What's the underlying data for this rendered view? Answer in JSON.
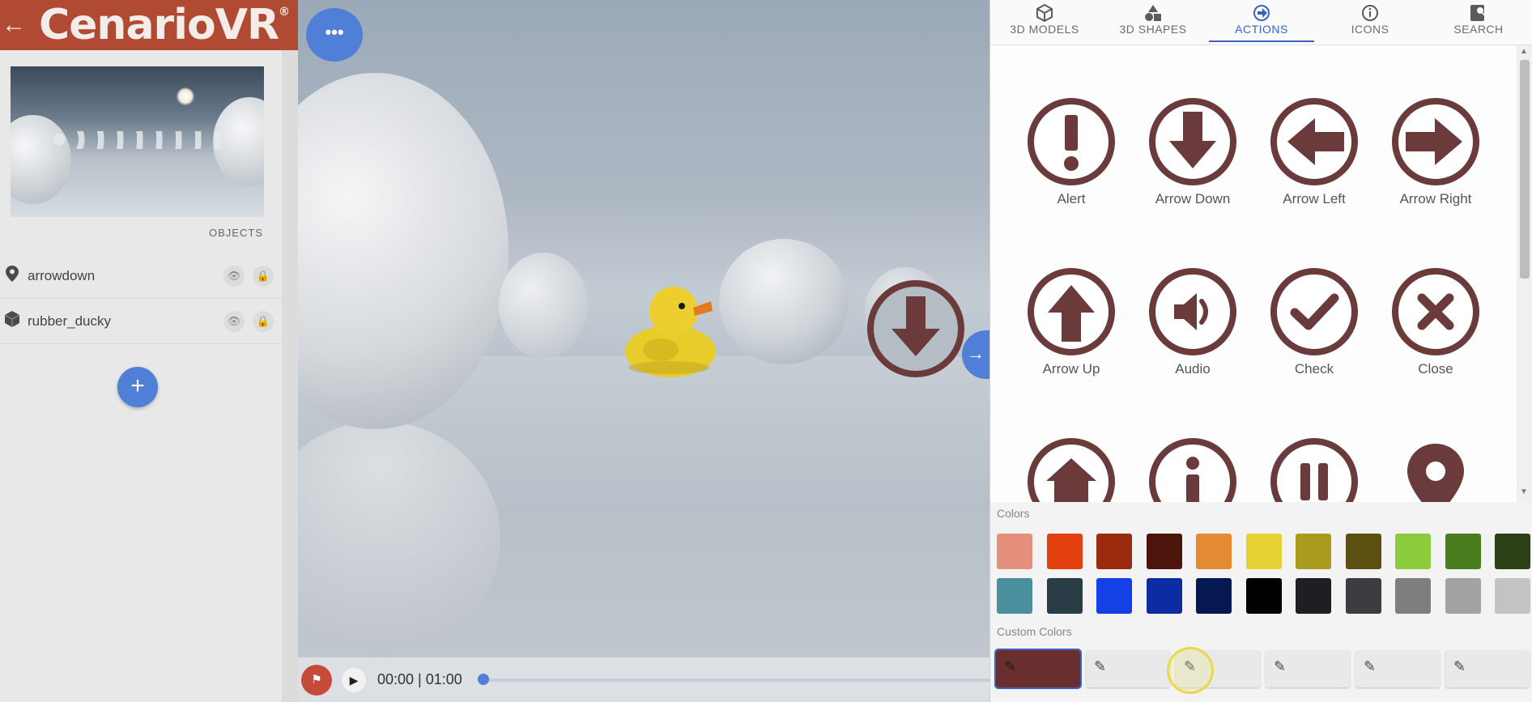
{
  "app": {
    "logo_text": "CenarioVR",
    "back_icon": "arrow-left-icon"
  },
  "sidebar": {
    "objects_label": "OBJECTS",
    "objects": [
      {
        "name": "arrowdown",
        "icon": "map-pin-icon"
      },
      {
        "name": "rubber_ducky",
        "icon": "cube-icon"
      }
    ],
    "add_button": "+"
  },
  "viewport": {
    "menu_button": "•••",
    "next_arrow": "→"
  },
  "timeline": {
    "time_readout": "00:00 | 01:00",
    "progress": 0
  },
  "panel": {
    "tabs": [
      {
        "label": "3D MODELS",
        "icon": "cube-icon"
      },
      {
        "label": "3D SHAPES",
        "icon": "shapes-icon"
      },
      {
        "label": "ACTIONS",
        "icon": "action-arrow-icon",
        "active": true
      },
      {
        "label": "ICONS",
        "icon": "info-icon"
      },
      {
        "label": "SEARCH",
        "icon": "search-icon"
      }
    ],
    "action_icons": [
      {
        "label": "Alert",
        "icon": "alert-icon"
      },
      {
        "label": "Arrow Down",
        "icon": "arrow-down-icon"
      },
      {
        "label": "Arrow Left",
        "icon": "arrow-left-icon"
      },
      {
        "label": "Arrow Right",
        "icon": "arrow-right-icon"
      },
      {
        "label": "Arrow Up",
        "icon": "arrow-up-icon"
      },
      {
        "label": "Audio",
        "icon": "audio-icon"
      },
      {
        "label": "Check",
        "icon": "check-icon"
      },
      {
        "label": "Close",
        "icon": "close-icon"
      },
      {
        "label": "",
        "icon": "home-icon"
      },
      {
        "label": "",
        "icon": "info-icon"
      },
      {
        "label": "",
        "icon": "pause-icon"
      },
      {
        "label": "",
        "icon": "location-pin-icon"
      }
    ],
    "icon_color": "#6b3a3a",
    "colors_title": "Colors",
    "colors": [
      "#e4907c",
      "#e2400f",
      "#9a2a0e",
      "#4d140c",
      "#e38a33",
      "#e6d232",
      "#aa9a1d",
      "#5b4f12",
      "#8bcb3c",
      "#4a7d1e",
      "#2b4015",
      "#7fd2e6",
      "#4a8f9e",
      "#2a3d47",
      "#1540e6",
      "#0d2ba3",
      "#061852",
      "#000000",
      "#1d1f22",
      "#3d3c40",
      "#7e7e7e",
      "#a3a3a3",
      "#c3c3c3",
      "#eeeeee"
    ],
    "custom_colors_title": "Custom Colors",
    "custom_colors": [
      "#6b2e2e",
      "",
      "",
      "",
      "",
      ""
    ]
  }
}
